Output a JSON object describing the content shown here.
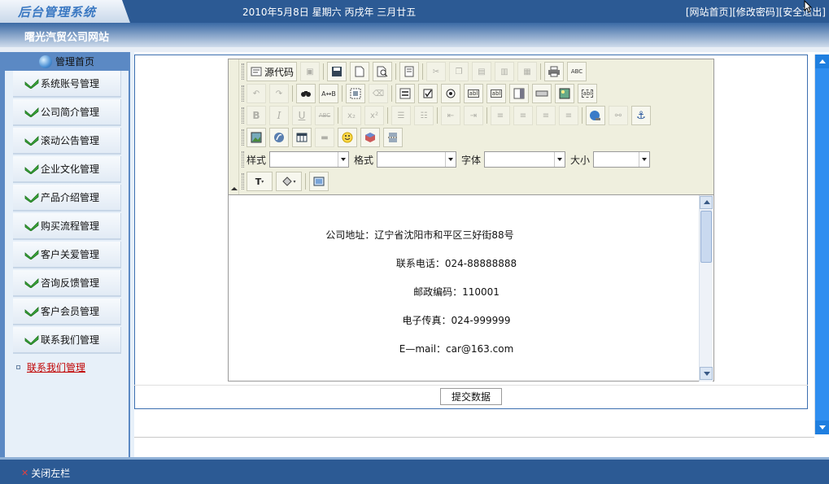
{
  "header": {
    "logo_text": "后台管理系统",
    "date": "2010年5月8日  星期六  丙戌年  三月廿五",
    "links": [
      "[网站首页]",
      "[修改密码]",
      "[安全退出]"
    ]
  },
  "subheader": {
    "site_name": "曙光汽贸公司网站"
  },
  "sidebar": {
    "home_label": "管理首页",
    "items": [
      {
        "label": "系统账号管理"
      },
      {
        "label": "公司简介管理"
      },
      {
        "label": "滚动公告管理"
      },
      {
        "label": "企业文化管理"
      },
      {
        "label": "产品介绍管理"
      },
      {
        "label": "购买流程管理"
      },
      {
        "label": "客户关爱管理"
      },
      {
        "label": "咨询反馈管理"
      },
      {
        "label": "客户会员管理"
      },
      {
        "label": "联系我们管理"
      }
    ],
    "selected_label": "联系我们管理"
  },
  "editor": {
    "source_button": "源代码",
    "combo_labels": {
      "style": "样式",
      "format": "格式",
      "font": "字体",
      "size": "大小"
    },
    "content_lines": [
      "公司地址：辽宁省沈阳市和平区三好街88号",
      "联系电话：024-88888888",
      "邮政编码：110001",
      "电子传真：024-999999",
      "E—mail：car@163.com"
    ]
  },
  "submit_button": "提交数据",
  "footer": {
    "close_left": "关闭左栏"
  },
  "colors": {
    "header_bg": "#2c5a94",
    "sidebar_bg": "#5b89c4",
    "selected_link": "#c00000",
    "scrollbar": "#1f7fe0"
  }
}
